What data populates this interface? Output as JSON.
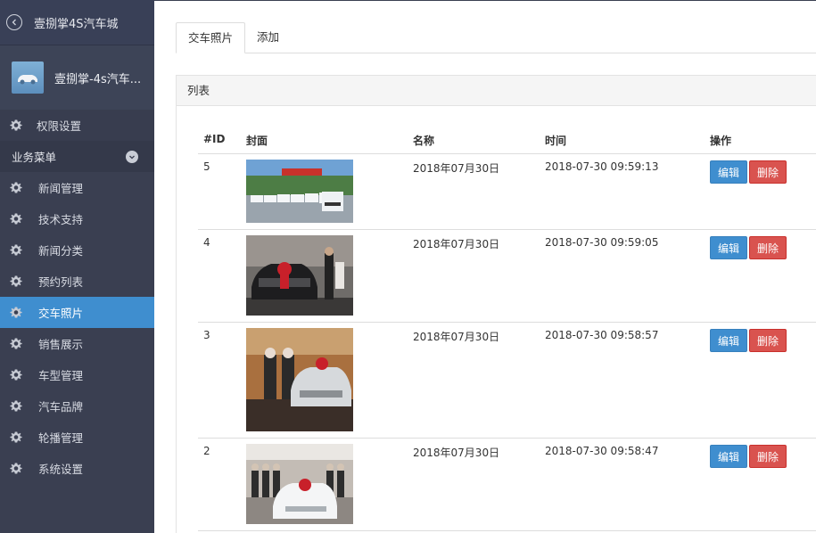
{
  "app": {
    "title": "壹捌掌4S汽车城",
    "user_name": "壹捌掌-4s汽车..."
  },
  "sidebar": {
    "permission_label": "权限设置",
    "section_label": "业务菜单",
    "items": [
      {
        "label": "新闻管理"
      },
      {
        "label": "技术支持"
      },
      {
        "label": "新闻分类"
      },
      {
        "label": "预约列表"
      },
      {
        "label": "交车照片"
      },
      {
        "label": "销售展示"
      },
      {
        "label": "车型管理"
      },
      {
        "label": "汽车品牌"
      },
      {
        "label": "轮播管理"
      },
      {
        "label": "系统设置"
      }
    ],
    "active_index": 4
  },
  "tabs": [
    {
      "label": "交车照片"
    },
    {
      "label": "添加"
    }
  ],
  "panel": {
    "title": "列表"
  },
  "table": {
    "headers": {
      "id": "#ID",
      "cover": "封面",
      "name": "名称",
      "time": "时间",
      "actions": "操作"
    },
    "rows": [
      {
        "id": "5",
        "name": "2018年07月30日",
        "time": "2018-07-30 09:59:13",
        "photo": "lineup of white cars outside dealership"
      },
      {
        "id": "4",
        "name": "2018年07月30日",
        "time": "2018-07-30 09:59:05",
        "photo": "black SUV with red bow in showroom"
      },
      {
        "id": "3",
        "name": "2018年07月30日",
        "time": "2018-07-30 09:58:57",
        "photo": "silver sedan with red bow in showroom"
      },
      {
        "id": "2",
        "name": "2018年07月30日",
        "time": "2018-07-30 09:58:47",
        "photo": "white sedan with red bow and staff"
      }
    ],
    "edit_label": "编辑",
    "delete_label": "删除"
  },
  "colors": {
    "sidebar_bg": "#3a3f51",
    "active_item": "#3f8ecf",
    "edit_button": "#3f8ecf",
    "delete_button": "#d9534f"
  }
}
